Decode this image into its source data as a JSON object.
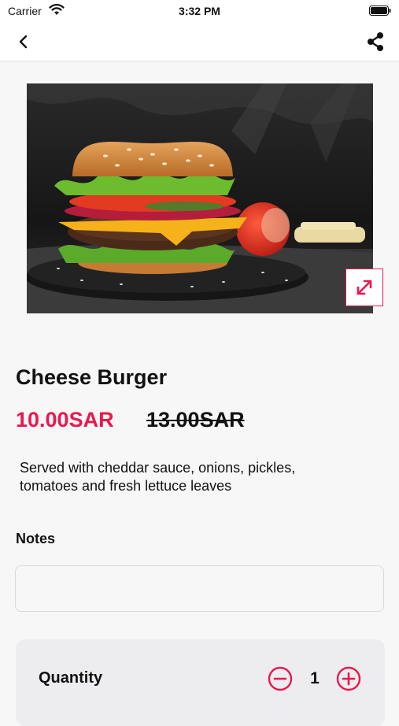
{
  "status_bar": {
    "carrier": "Carrier",
    "time": "3:32 PM"
  },
  "nav": {
    "back_icon": "chevron-left-icon",
    "share_icon": "share-icon"
  },
  "product": {
    "image_icon": "burger-photo",
    "title": "Cheese Burger",
    "price": "10.00SAR",
    "old_price": "13.00SAR",
    "description": "Served with cheddar sauce, onions, pickles, tomatoes and fresh lettuce leaves"
  },
  "notes": {
    "label": "Notes",
    "value": "",
    "placeholder": ""
  },
  "quantity": {
    "label": "Quantity",
    "value": "1"
  },
  "colors": {
    "accent": "#e8194f",
    "background": "#f7f7f8",
    "card": "#ededf0"
  }
}
